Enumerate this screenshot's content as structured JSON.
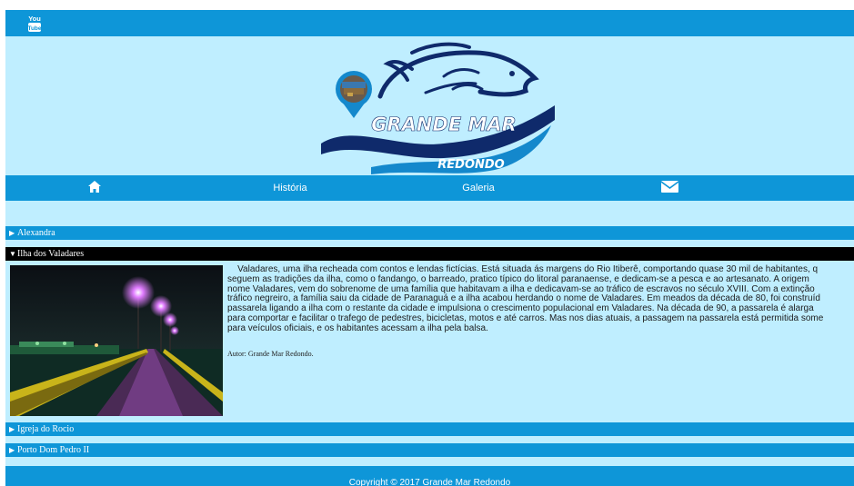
{
  "topbar": {
    "icon": "youtube-icon",
    "icon_text_1": "You",
    "icon_text_2": "Tube"
  },
  "logo": {
    "line1": "GRANDE MAR",
    "line2": "REDONDO",
    "icon": "fish-logo"
  },
  "nav": {
    "home_icon": "home-icon",
    "historia": "História",
    "galeria": "Galeria",
    "mail_icon": "envelope-icon"
  },
  "accordion": [
    {
      "label": "Alexandra",
      "open": false
    },
    {
      "label": "Ilha dos Valadares",
      "open": true
    },
    {
      "label": "Igreja do Rocio",
      "open": false
    },
    {
      "label": "Porto Dom Pedro II",
      "open": false
    }
  ],
  "article": {
    "lines": [
      "    Valadares, uma ilha recheada com contos e lendas fictícias. Está situada ás margens do Rio Itiberê, comportando quase 30 mil de habitantes, q",
      "seguem as tradições da ilha, como o fandango, o barreado, pratico típico do litoral paranaense, e dedicam-se a pesca e ao artesanato. A origem",
      "nome Valadares, vem do sobrenome de uma família que habitavam a ilha e dedicavam-se ao tráfico de escravos no século XVIII. Com a extinção",
      "tráfico negreiro, a família saiu da cidade de Paranaguá e a ilha acabou herdando o nome de Valadares. Em meados da década de 80, foi construíd",
      "passarela ligando a ilha com o restante da cidade e impulsiona o crescimento populacional em Valadares. Na década de 90, a passarela é alarga",
      "para comportar e facilitar o trafego de pedestres, bicicletas, motos e até carros. Mas nos dias atuais, a passagem na passarela está permitida some",
      "para veículos oficiais, e os habitantes acessam a ilha pela balsa."
    ],
    "author": "Autor: Grande Mar Redondo.",
    "photo": "night-bridge-photo"
  },
  "footer": {
    "text": "Copyright © 2017 Grande Mar Redondo"
  },
  "colors": {
    "primary": "#0e96d8",
    "background": "#bfeeff",
    "logo_dark": "#0f2a6b"
  }
}
